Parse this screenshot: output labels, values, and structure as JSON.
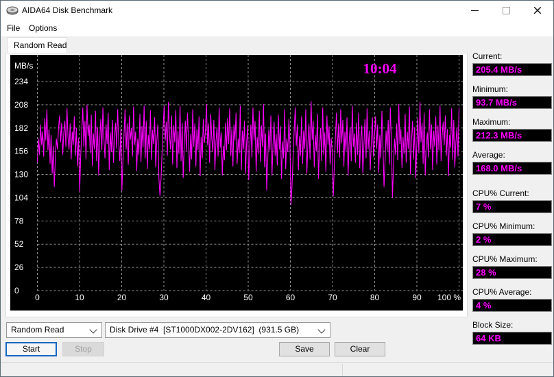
{
  "window": {
    "title": "AIDA64 Disk Benchmark"
  },
  "menu": {
    "items": [
      {
        "label": "File"
      },
      {
        "label": "Options"
      }
    ]
  },
  "tab": {
    "label": "Random Read"
  },
  "chart_data": {
    "type": "line",
    "overlay_time": "10:04",
    "unit_label": "MB/s",
    "y_ticks": [
      "234",
      "208",
      "182",
      "156",
      "130",
      "104",
      "78",
      "52",
      "26",
      "0"
    ],
    "x_ticks": [
      "0",
      "10",
      "20",
      "30",
      "40",
      "50",
      "60",
      "70",
      "80",
      "90",
      "100 %"
    ],
    "ylim": [
      0,
      260
    ],
    "xlim": [
      0,
      100
    ],
    "line_color": "#ff00ff",
    "grid_color": "#8f8f8f",
    "axis_text_color": "#ffffff",
    "values": [
      144,
      170,
      152,
      186,
      163,
      178,
      150,
      193,
      168,
      203,
      157,
      181,
      142,
      174,
      131,
      162,
      116,
      148,
      170,
      158,
      181,
      196,
      166,
      188,
      152,
      176,
      190,
      161,
      204,
      172,
      158,
      187,
      147,
      178,
      163,
      195,
      151,
      182,
      139,
      171,
      111,
      150,
      178,
      205,
      161,
      190,
      147,
      208,
      173,
      186,
      154,
      197,
      139,
      176,
      158,
      201,
      145,
      183,
      129,
      168,
      192,
      157,
      205,
      170,
      148,
      186,
      164,
      199,
      135,
      177,
      155,
      191,
      143,
      173,
      188,
      159,
      203,
      166,
      145,
      181,
      112,
      146,
      175,
      203,
      158,
      187,
      141,
      196,
      169,
      182,
      150,
      206,
      163,
      178,
      134,
      170,
      152,
      198,
      144,
      184,
      160,
      207,
      148,
      190,
      136,
      174,
      158,
      202,
      146,
      180,
      164,
      194,
      138,
      168,
      186,
      125,
      106,
      124,
      155,
      183,
      207,
      168,
      189,
      151,
      211,
      174,
      158,
      196,
      141,
      185,
      166,
      202,
      137,
      179,
      153,
      207,
      145,
      188,
      126,
      164,
      190,
      156,
      199,
      170,
      133,
      175,
      147,
      203,
      161,
      187,
      139,
      181,
      157,
      195,
      128,
      172,
      148,
      192,
      165,
      178,
      209,
      163,
      187,
      143,
      198,
      171,
      155,
      191,
      135,
      167,
      183,
      150,
      205,
      160,
      177,
      129,
      162,
      146,
      188,
      157,
      193,
      164,
      204,
      151,
      181,
      139,
      186,
      168,
      199,
      142,
      170,
      154,
      207,
      135,
      179,
      158,
      190,
      131,
      166,
      185,
      124,
      160,
      186,
      149,
      205,
      168,
      190,
      133,
      172,
      153,
      201,
      144,
      185,
      161,
      209,
      138,
      176,
      112,
      146,
      181,
      157,
      196,
      129,
      163,
      189,
      151,
      175,
      140,
      197,
      158,
      184,
      125,
      167,
      148,
      203,
      136,
      170,
      155,
      192,
      164,
      96,
      118,
      150,
      178,
      205,
      162,
      186,
      135,
      173,
      151,
      195,
      142,
      179,
      159,
      203,
      131,
      165,
      187,
      147,
      212,
      169,
      190,
      138,
      174,
      156,
      198,
      125,
      160,
      182,
      145,
      205,
      152,
      177,
      133,
      196,
      163,
      184,
      141,
      171,
      155,
      106,
      140,
      172,
      199,
      154,
      187,
      149,
      203,
      165,
      191,
      139,
      178,
      156,
      194,
      129,
      166,
      183,
      145,
      207,
      161,
      176,
      143,
      188,
      152,
      199,
      137,
      170,
      185,
      131,
      164,
      192,
      148,
      204,
      158,
      179,
      135,
      167,
      194,
      150,
      173,
      195,
      159,
      186,
      132,
      174,
      148,
      201,
      163,
      116,
      145,
      179,
      156,
      191,
      141,
      205,
      167,
      104,
      138,
      170,
      152,
      187,
      146,
      209,
      164,
      181,
      137,
      172,
      153,
      198,
      143,
      178,
      159,
      206,
      130,
      168,
      190,
      147,
      183,
      126,
      161,
      193,
      154,
      211,
      166,
      188,
      142,
      199,
      129,
      164,
      177,
      149,
      203,
      158,
      186,
      135,
      179,
      161,
      195,
      141,
      185,
      157,
      207,
      145,
      173,
      189,
      163,
      196,
      151,
      181,
      128,
      174,
      160,
      204,
      147,
      191,
      138,
      166,
      183,
      150,
      205
    ]
  },
  "stats": [
    {
      "label": "Current:",
      "value": "205.4 MB/s"
    },
    {
      "label": "Minimum:",
      "value": "93.7 MB/s"
    },
    {
      "label": "Maximum:",
      "value": "212.3 MB/s"
    },
    {
      "label": "Average:",
      "value": "168.0 MB/s"
    },
    {
      "label": "CPU% Current:",
      "value": "7 %"
    },
    {
      "label": "CPU% Minimum:",
      "value": "2 %"
    },
    {
      "label": "CPU% Maximum:",
      "value": "28 %"
    },
    {
      "label": "CPU% Average:",
      "value": "4 %"
    },
    {
      "label": "Block Size:",
      "value": "64 KB"
    }
  ],
  "controls": {
    "test_select_value": "Random Read",
    "drive_select_value": "Disk Drive #4  [ST1000DX002-2DV162]  (931.5 GB)",
    "start_label": "Start",
    "stop_label": "Stop",
    "save_label": "Save",
    "clear_label": "Clear"
  }
}
